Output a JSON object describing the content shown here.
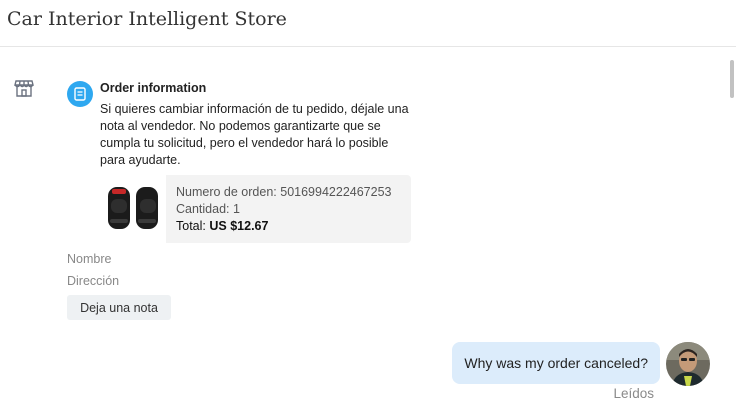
{
  "header": {
    "store_name": "Car Interior Intelligent Store"
  },
  "order": {
    "title": "Order information",
    "description": "Si quieres cambiar información de tu pedido, déjale una nota al vendedor. No podemos garantizarte que se cumpla tu solicitud, pero el vendedor hará lo posible para ayudarte.",
    "order_number_label": "Numero de orden:",
    "order_number": "5016994222467253",
    "quantity_label": "Cantidad:",
    "quantity": "1",
    "total_label": "Total:",
    "total_value": "US $12.67",
    "icon": "order-document-icon",
    "accent_color": "#2ea8f0"
  },
  "fields": {
    "name_label": "Nombre",
    "address_label": "Dirección"
  },
  "note_button": {
    "label": "Deja una nota"
  },
  "message": {
    "text": "Why was my order canceled?",
    "status": "Leídos",
    "bubble_color": "#dcecfb"
  },
  "icons": {
    "store": "store-icon",
    "avatar": "user-avatar"
  }
}
